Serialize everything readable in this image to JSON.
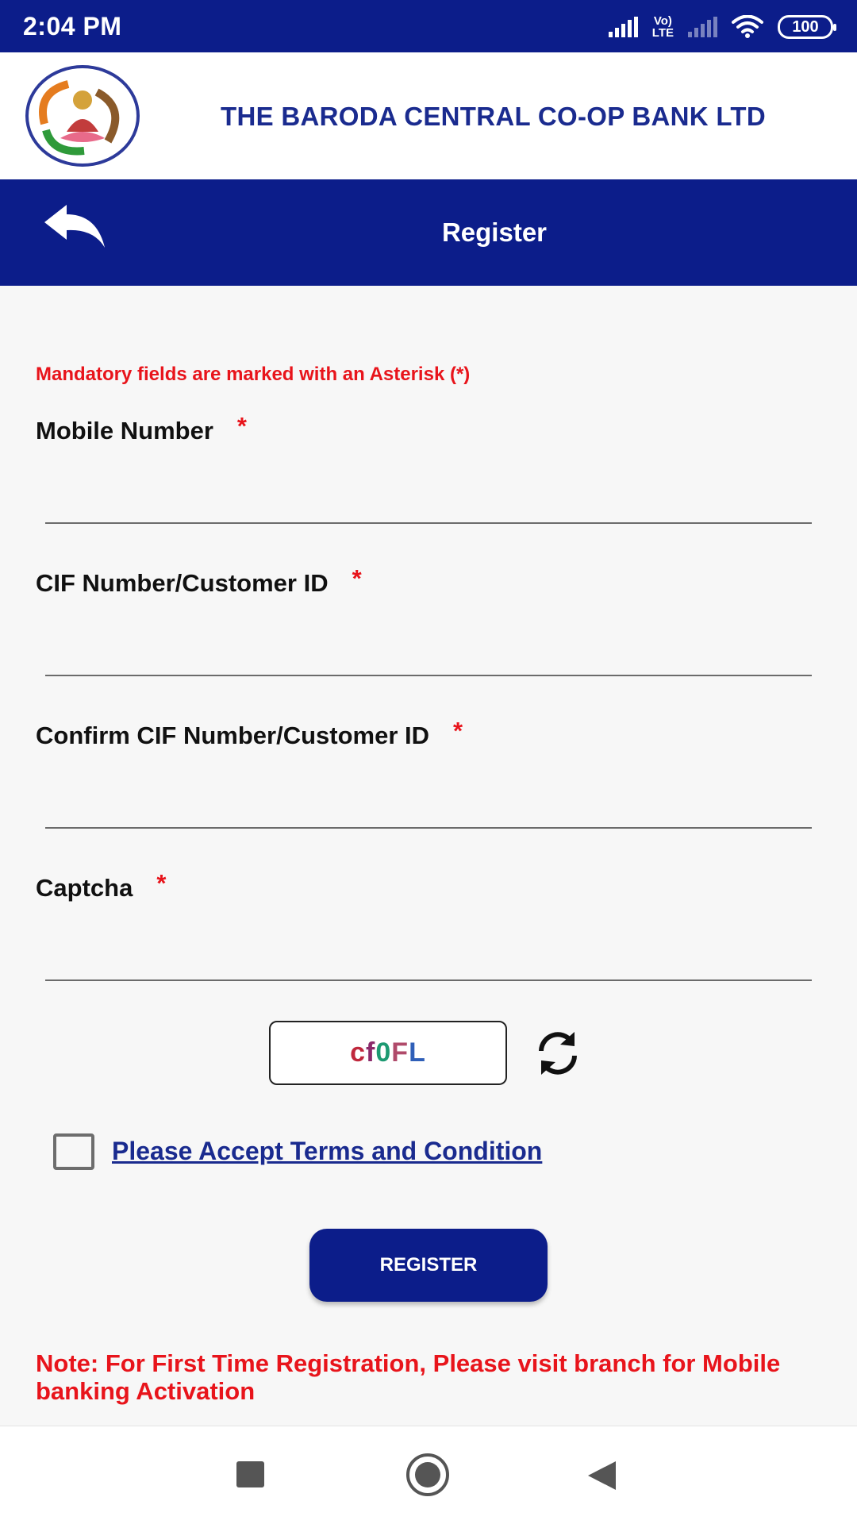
{
  "status_bar": {
    "time": "2:04 PM",
    "network_label_top": "Vo)",
    "network_label_bottom": "LTE",
    "battery": "100"
  },
  "header": {
    "bank_name": "THE BARODA CENTRAL CO-OP BANK LTD",
    "logo_icon": "bank-logo-icon"
  },
  "title_bar": {
    "title": "Register",
    "back_icon": "back-arrow-icon"
  },
  "form": {
    "mandatory_note": "Mandatory fields are marked with an Asterisk (*)",
    "required_marker": "*",
    "fields": [
      {
        "label": "Mobile Number",
        "value": "",
        "placeholder": ""
      },
      {
        "label": "CIF Number/Customer ID",
        "value": "",
        "placeholder": ""
      },
      {
        "label": "Confirm CIF Number/Customer ID",
        "value": "",
        "placeholder": ""
      },
      {
        "label": "Captcha",
        "value": "",
        "placeholder": ""
      }
    ],
    "captcha": {
      "chars": [
        {
          "char": "c",
          "color": "#c0283d"
        },
        {
          "char": "f",
          "color": "#8b2a6b"
        },
        {
          "char": "0",
          "color": "#1d9a72"
        },
        {
          "char": "F",
          "color": "#b04a6a"
        },
        {
          "char": "L",
          "color": "#2f5fb8"
        }
      ]
    },
    "terms_label": "Please Accept Terms and Condition",
    "terms_checked": false,
    "register_label": "REGISTER",
    "bottom_note": "Note: For First Time Registration, Please visit branch for Mobile banking Activation"
  },
  "colors": {
    "primary": "#0c1d8a",
    "accent_red": "#e8141b",
    "link": "#1a2b8f"
  }
}
